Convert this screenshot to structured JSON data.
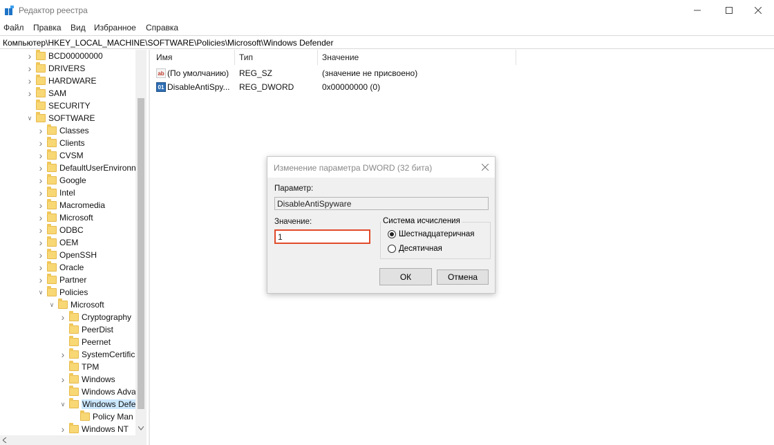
{
  "window": {
    "title": "Редактор реестра"
  },
  "menu": [
    "Файл",
    "Правка",
    "Вид",
    "Избранное",
    "Справка"
  ],
  "address": "Компьютер\\HKEY_LOCAL_MACHINE\\SOFTWARE\\Policies\\Microsoft\\Windows Defender",
  "tree": [
    {
      "label": "BCD00000000",
      "chev": "right"
    },
    {
      "label": "DRIVERS",
      "chev": "right"
    },
    {
      "label": "HARDWARE",
      "chev": "right"
    },
    {
      "label": "SAM",
      "chev": "right"
    },
    {
      "label": "SECURITY",
      "chev": ""
    },
    {
      "label": "SOFTWARE",
      "chev": "down"
    },
    {
      "label": "Classes",
      "chev": "right"
    },
    {
      "label": "Clients",
      "chev": "right"
    },
    {
      "label": "CVSM",
      "chev": "right"
    },
    {
      "label": "DefaultUserEnvironn",
      "chev": "right"
    },
    {
      "label": "Google",
      "chev": "right"
    },
    {
      "label": "Intel",
      "chev": "right"
    },
    {
      "label": "Macromedia",
      "chev": "right"
    },
    {
      "label": "Microsoft",
      "chev": "right"
    },
    {
      "label": "ODBC",
      "chev": "right"
    },
    {
      "label": "OEM",
      "chev": "right"
    },
    {
      "label": "OpenSSH",
      "chev": "right"
    },
    {
      "label": "Oracle",
      "chev": "right"
    },
    {
      "label": "Partner",
      "chev": "right"
    },
    {
      "label": "Policies",
      "chev": "down"
    },
    {
      "label": "Microsoft",
      "chev": "down"
    },
    {
      "label": "Cryptography",
      "chev": "right"
    },
    {
      "label": "PeerDist",
      "chev": ""
    },
    {
      "label": "Peernet",
      "chev": ""
    },
    {
      "label": "SystemCertific",
      "chev": "right"
    },
    {
      "label": "TPM",
      "chev": ""
    },
    {
      "label": "Windows",
      "chev": "right"
    },
    {
      "label": "Windows Adva",
      "chev": ""
    },
    {
      "label": "Windows Defe",
      "chev": "down",
      "selected": true
    },
    {
      "label": "Policy Man",
      "chev": ""
    },
    {
      "label": "Windows NT",
      "chev": "right"
    }
  ],
  "columns": {
    "name": "Имя",
    "type": "Тип",
    "value": "Значение"
  },
  "values": [
    {
      "icon": "string-value-icon",
      "name": "(По умолчанию)",
      "type": "REG_SZ",
      "data": "(значение не присвоено)"
    },
    {
      "icon": "dword-value-icon",
      "name": "DisableAntiSpy...",
      "type": "REG_DWORD",
      "data": "0x00000000 (0)"
    }
  ],
  "dialog": {
    "title": "Изменение параметра DWORD (32 бита)",
    "param_label": "Параметр:",
    "param_value": "DisableAntiSpyware",
    "value_label": "Значение:",
    "value_input": "1",
    "base_label": "Система исчисления",
    "hex_label": "Шестнадцатеричная",
    "dec_label": "Десятичная",
    "ok_label": "ОК",
    "cancel_label": "Отмена"
  },
  "colors": {
    "highlight": "#e04a2a",
    "selection": "#cce8ff",
    "folder": "#f8d775"
  }
}
